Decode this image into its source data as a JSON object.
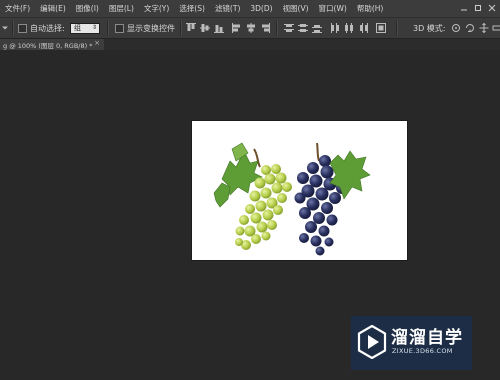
{
  "menu": [
    "文件(F)",
    "编辑(E)",
    "图像(I)",
    "图层(L)",
    "文字(Y)",
    "选择(S)",
    "滤镜(T)",
    "3D(D)",
    "视图(V)",
    "窗口(W)",
    "帮助(H)"
  ],
  "options": {
    "auto_select_label": "自动选择:",
    "auto_select_value": "组",
    "show_transform_label": "显示变换控件",
    "mode_label": "3D 模式:"
  },
  "document_tab": {
    "title": "g @ 100% (图层 0, RGB/8) *",
    "close_icon": "×"
  },
  "watermark": {
    "brand": "溜溜自学",
    "url": "ZIXUE.3D66.COM"
  },
  "colors": {
    "workspace": "#282828",
    "menubar": "#3c3c3c",
    "green_grape": "#b6cf4e",
    "purple_grape": "#28305a",
    "leaf": "#5f9a34"
  }
}
